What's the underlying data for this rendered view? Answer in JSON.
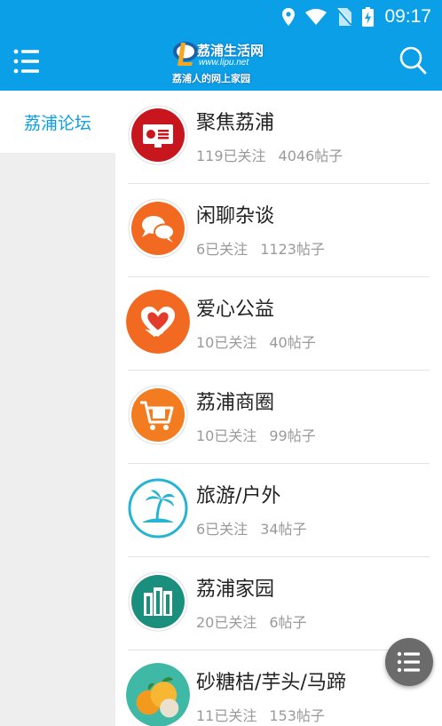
{
  "status_bar": {
    "time": "09:17",
    "icons": [
      "location-icon",
      "wifi-icon",
      "no-sim-icon",
      "battery-charging-icon"
    ]
  },
  "app_bar": {
    "logo": {
      "title": "荔浦生活网",
      "url": "www.lipu.net",
      "slogan": "荔浦人的网上家园"
    },
    "left_icon": "menu-icon",
    "right_icon": "search-icon"
  },
  "sidebar": {
    "items": [
      {
        "label": "荔浦论坛",
        "selected": true
      }
    ]
  },
  "forums": [
    {
      "name": "聚焦荔浦",
      "followers": "119已关注",
      "posts": "4046帖子",
      "icon": "presentation-icon",
      "color": "#c8161e"
    },
    {
      "name": "闲聊杂谈",
      "followers": "6已关注",
      "posts": "1123帖子",
      "icon": "chat-bubbles-icon",
      "color": "#f26a21"
    },
    {
      "name": "爱心公益",
      "followers": "10已关注",
      "posts": "40帖子",
      "icon": "heart-hand-icon",
      "color": "#f26a21"
    },
    {
      "name": "荔浦商圈",
      "followers": "10已关注",
      "posts": "99帖子",
      "icon": "shopping-cart-icon",
      "color": "#f47c20"
    },
    {
      "name": "旅游/户外",
      "followers": "6已关注",
      "posts": "34帖子",
      "icon": "palm-island-icon",
      "color": "#27b4d4"
    },
    {
      "name": "荔浦家园",
      "followers": "20已关注",
      "posts": "6帖子",
      "icon": "buildings-icon",
      "color": "#1a8f7d"
    },
    {
      "name": "砂糖桔/芋头/马蹄",
      "followers": "11已关注",
      "posts": "153帖子",
      "icon": "citrus-fruit-icon",
      "color": "#3fb8a6"
    }
  ],
  "fab": {
    "icon": "menu-icon"
  }
}
